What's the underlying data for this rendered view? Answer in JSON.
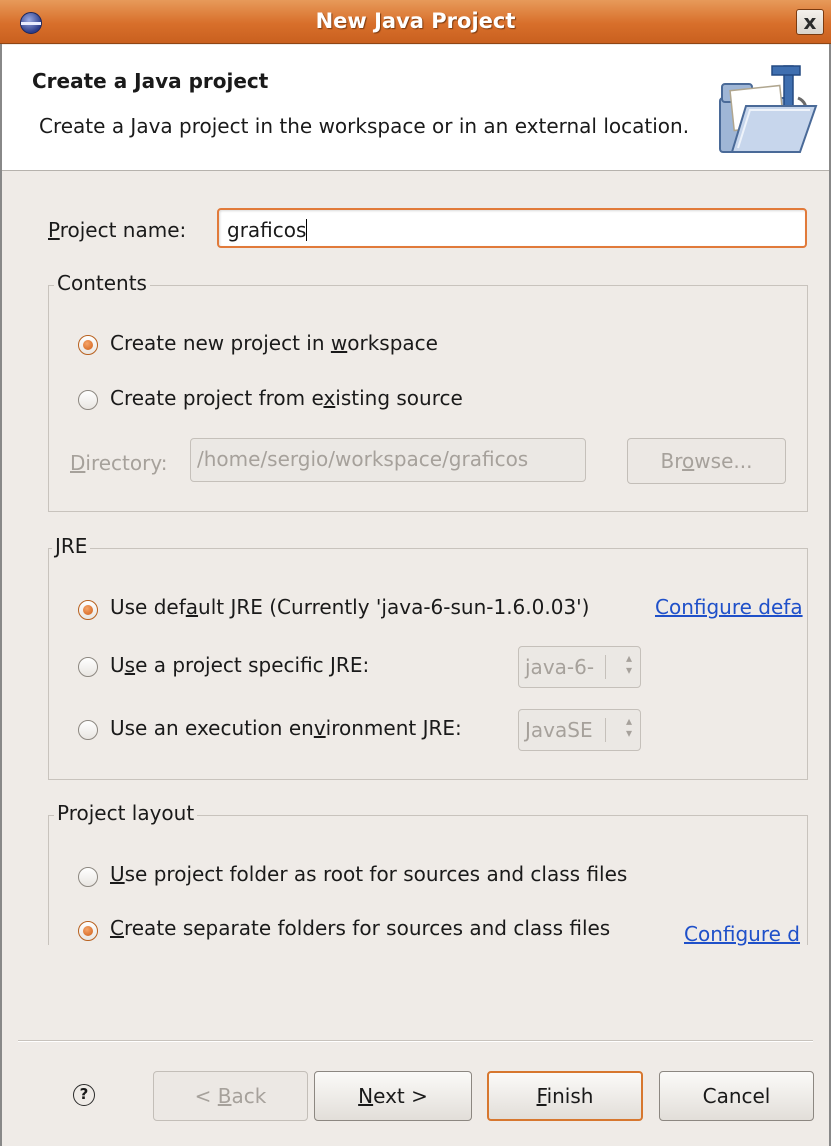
{
  "window": {
    "title": "New Java Project",
    "close_glyph": "x",
    "icon": "eclipse-icon"
  },
  "header": {
    "title": "Create a Java project",
    "description": "Create a Java project in the workspace or in an external location.",
    "icon": "java-project-folder-icon"
  },
  "project_name": {
    "label_prefix": "P",
    "label_rest": "roject name:",
    "value": "graficos"
  },
  "contents": {
    "label": "Contents",
    "options": [
      {
        "pre": "Create new project in ",
        "key": "w",
        "post": "orkspace",
        "selected": true
      },
      {
        "pre": "Create project from e",
        "key": "x",
        "post": "isting source",
        "selected": false
      }
    ],
    "directory_label_key": "D",
    "directory_label_rest": "irectory:",
    "directory_value": "/home/sergio/workspace/graficos",
    "browse_pre": "Br",
    "browse_key": "o",
    "browse_post": "wse..."
  },
  "jre": {
    "label": "JRE",
    "options": [
      {
        "pre": "Use def",
        "key": "a",
        "post": "ult JRE (Currently 'java-6-sun-1.6.0.03')",
        "selected": true
      },
      {
        "pre": "U",
        "key": "s",
        "post": "e a project specific JRE:",
        "selected": false
      },
      {
        "pre": "Use an execution en",
        "key": "v",
        "post": "ironment JRE:",
        "selected": false
      }
    ],
    "configure_link": "Configure defa",
    "specific_jre_value": "java-6-",
    "env_jre_value": "JavaSE"
  },
  "layout": {
    "label": "Project layout",
    "options": [
      {
        "pre": "",
        "key": "U",
        "post": "se project folder as root for sources and class files",
        "selected": false
      },
      {
        "pre": "",
        "key": "C",
        "post": "reate separate folders for sources and class files",
        "selected": true
      }
    ],
    "configure_link": "Configure d"
  },
  "buttons": {
    "help": "?",
    "back_pre": "< ",
    "back_key": "B",
    "back_post": "ack",
    "next_key": "N",
    "next_post": "ext >",
    "finish_key": "F",
    "finish_post": "inish",
    "cancel": "Cancel"
  }
}
